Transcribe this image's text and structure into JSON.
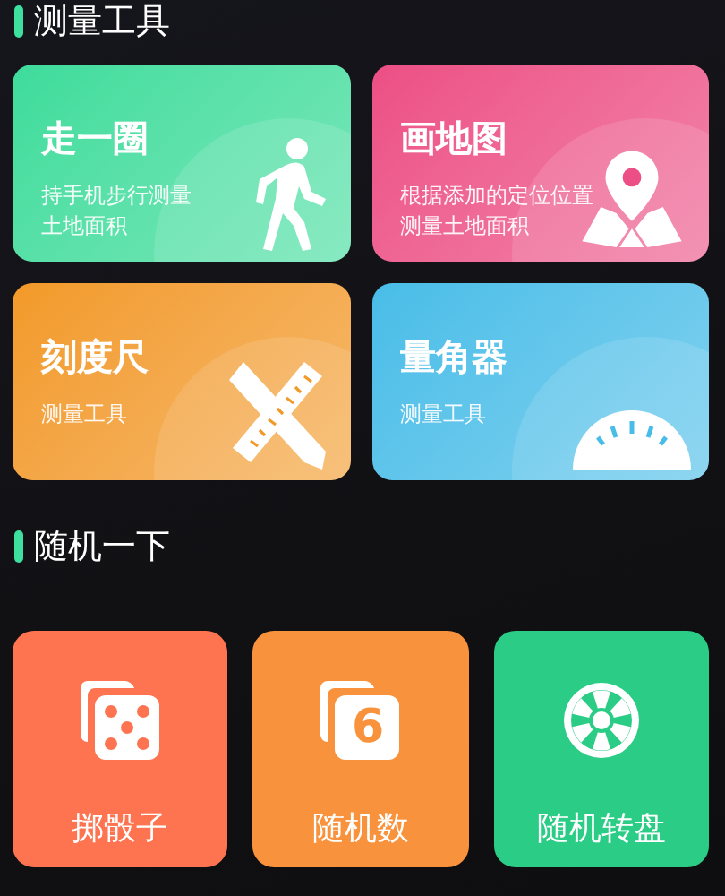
{
  "sections": [
    {
      "title": "测量工具",
      "kind": "cards",
      "items": [
        {
          "title": "走一圈",
          "subtitle_lines": [
            "持手机步行测量",
            "土地面积"
          ],
          "kind": "walk",
          "color": "#3ddc9c"
        },
        {
          "title": "画地图",
          "subtitle_lines": [
            "根据添加的定位位置",
            "测量土地面积"
          ],
          "kind": "map",
          "color": "#ec4f85"
        },
        {
          "title": "刻度尺",
          "subtitle_lines": [
            "测量工具"
          ],
          "kind": "ruler",
          "color": "#f29a28"
        },
        {
          "title": "量角器",
          "subtitle_lines": [
            "测量工具"
          ],
          "kind": "protractor",
          "color": "#48bde8"
        }
      ]
    },
    {
      "title": "随机一下",
      "kind": "tiles",
      "items": [
        {
          "title": "掷骰子",
          "kind": "dice",
          "color": "#fe7451"
        },
        {
          "title": "随机数",
          "kind": "number",
          "icon_digit": "6",
          "color": "#f8923d"
        },
        {
          "title": "随机转盘",
          "kind": "wheel",
          "color": "#2bcc85"
        }
      ]
    }
  ]
}
